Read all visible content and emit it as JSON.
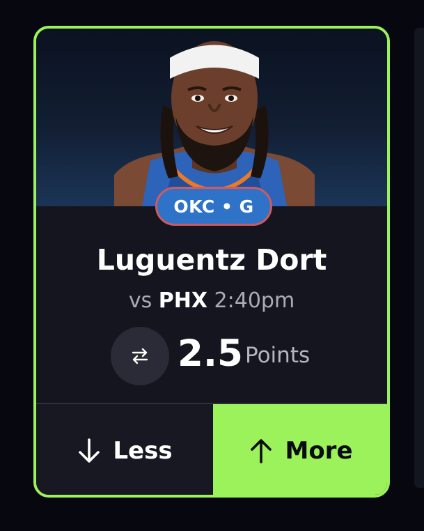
{
  "card": {
    "accent_color": "#9cf25a",
    "player_photo_icon": "player-headshot-image",
    "team_position_badge": "OKC • G",
    "badge_color": "#2f73c8",
    "player_name": "Luguentz Dort",
    "matchup_prefix": "vs",
    "opponent": "PHX",
    "game_time": "2:40pm",
    "swap_icon": "swap-arrows-icon",
    "line_value": "2.5",
    "stat_type": "Points",
    "less_label": "Less",
    "less_icon": "arrow-down-icon",
    "more_label": "More",
    "more_icon": "arrow-up-icon",
    "selected_option": "More"
  }
}
